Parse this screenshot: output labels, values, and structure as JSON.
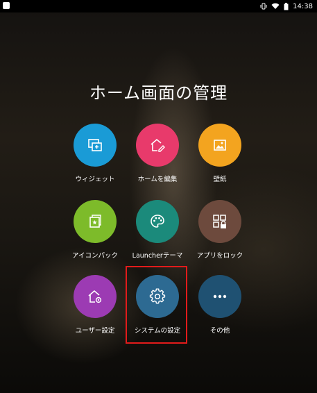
{
  "status_bar": {
    "time": "14:38",
    "icons": [
      "app-notification-icon",
      "vibrate-icon",
      "wifi-icon",
      "battery-icon"
    ]
  },
  "title": "ホーム画面の管理",
  "items": [
    {
      "label": "ウィジェット",
      "color": "#1a9bd6",
      "icon": "widget-icon"
    },
    {
      "label": "ホームを編集",
      "color": "#e83a6b",
      "icon": "home-edit-icon"
    },
    {
      "label": "壁紙",
      "color": "#f3a41f",
      "icon": "wallpaper-icon"
    },
    {
      "label": "アイコンパック",
      "color": "#7dbb2a",
      "icon": "icon-pack-icon"
    },
    {
      "label": "Launcherテーマ",
      "color": "#1b8a7b",
      "icon": "palette-icon"
    },
    {
      "label": "アプリをロック",
      "color": "#6d4a3d",
      "icon": "app-lock-icon"
    },
    {
      "label": "ユーザー設定",
      "color": "#9c3bb3",
      "icon": "user-settings-icon"
    },
    {
      "label": "システムの設定",
      "color": "#2d6a92",
      "icon": "gear-icon"
    },
    {
      "label": "その他",
      "color": "#1f5172",
      "icon": "more-icon"
    }
  ]
}
